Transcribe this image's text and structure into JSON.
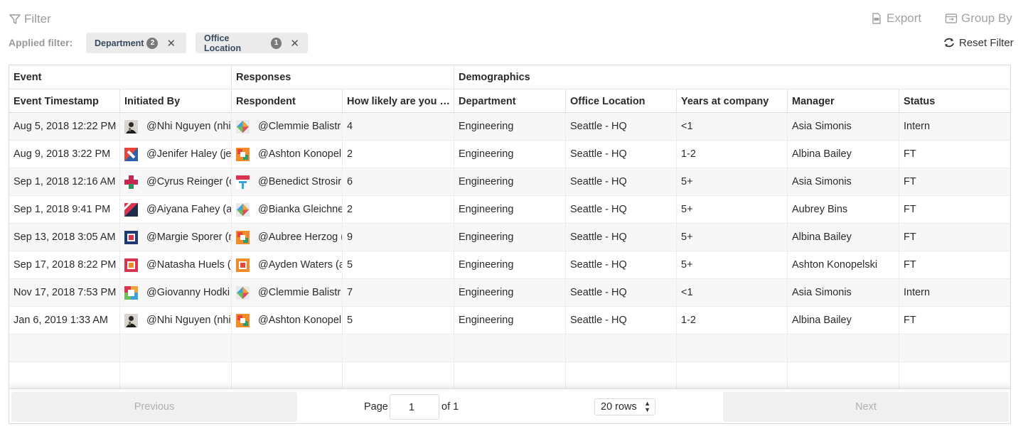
{
  "toolbar": {
    "filter_label": "Filter",
    "export_label": "Export",
    "group_by_label": "Group By",
    "reset_label": "Reset Filter",
    "applied_label": "Applied filter:",
    "chips": [
      {
        "label": "Department",
        "count": "2"
      },
      {
        "label": "Office Location",
        "count": "1"
      }
    ]
  },
  "table": {
    "groups": [
      "Event",
      "Responses",
      "Demographics"
    ],
    "columns": [
      "Event Timestamp",
      "Initiated By",
      "Respondent",
      "How likely are you …",
      "Department",
      "Office Location",
      "Years at company",
      "Manager",
      "Status"
    ],
    "rows": [
      {
        "timestamp": "Aug 5, 2018 12:22 PM",
        "initiated": "@Nhi Nguyen (nhi",
        "initiated_avatar": "photo",
        "respondent": "@Clemmie Balistr",
        "respondent_avatar": "diamond",
        "score": "4",
        "department": "Engineering",
        "office": "Seattle - HQ",
        "years": "<1",
        "manager": "Asia Simonis",
        "status": "Intern"
      },
      {
        "timestamp": "Aug 9, 2018 3:22 PM",
        "initiated": "@Jenifer Haley (je",
        "initiated_avatar": "diagonal",
        "respondent": "@Ashton Konopel",
        "respondent_avatar": "squares",
        "score": "2",
        "department": "Engineering",
        "office": "Seattle - HQ",
        "years": "1-2",
        "manager": "Albina Bailey",
        "status": "FT"
      },
      {
        "timestamp": "Sep 1, 2018 12:16 AM",
        "initiated": "@Cyrus Reinger (c",
        "initiated_avatar": "cross",
        "respondent": "@Benedict Strosir",
        "respondent_avatar": "calendar",
        "score": "6",
        "department": "Engineering",
        "office": "Seattle - HQ",
        "years": "5+",
        "manager": "Asia Simonis",
        "status": "FT"
      },
      {
        "timestamp": "Sep 1, 2018 9:41 PM",
        "initiated": "@Aiyana Fahey (a",
        "initiated_avatar": "split",
        "respondent": "@Bianka Gleichne",
        "respondent_avatar": "diamond",
        "score": "2",
        "department": "Engineering",
        "office": "Seattle - HQ",
        "years": "5+",
        "manager": "Aubrey Bins",
        "status": "FT"
      },
      {
        "timestamp": "Sep 13, 2018 3:05 AM",
        "initiated": "@Margie Sporer (r",
        "initiated_avatar": "frame-blue",
        "respondent": "@Aubree Herzog (",
        "respondent_avatar": "squares",
        "score": "9",
        "department": "Engineering",
        "office": "Seattle - HQ",
        "years": "5+",
        "manager": "Albina Bailey",
        "status": "FT"
      },
      {
        "timestamp": "Sep 17, 2018 8:22 PM",
        "initiated": "@Natasha Huels (",
        "initiated_avatar": "frame-red",
        "respondent": "@Ayden Waters (a",
        "respondent_avatar": "frame-orange",
        "score": "5",
        "department": "Engineering",
        "office": "Seattle - HQ",
        "years": "5+",
        "manager": "Ashton Konopelski",
        "status": "FT"
      },
      {
        "timestamp": "Nov 17, 2018 7:53 PM",
        "initiated": "@Giovanny Hodki",
        "initiated_avatar": "frame-multi",
        "respondent": "@Clemmie Balistr",
        "respondent_avatar": "diamond",
        "score": "7",
        "department": "Engineering",
        "office": "Seattle - HQ",
        "years": "<1",
        "manager": "Asia Simonis",
        "status": "Intern"
      },
      {
        "timestamp": "Jan 6, 2019 1:33 AM",
        "initiated": "@Nhi Nguyen (nhi",
        "initiated_avatar": "photo",
        "respondent": "@Ashton Konopel",
        "respondent_avatar": "squares",
        "score": "5",
        "department": "Engineering",
        "office": "Seattle - HQ",
        "years": "1-2",
        "manager": "Albina Bailey",
        "status": "FT"
      }
    ]
  },
  "pagination": {
    "previous_label": "Previous",
    "next_label": "Next",
    "page_label": "Page",
    "page_value": "1",
    "of_label": "of 1",
    "rows_label": "20 rows"
  },
  "colors": {
    "chip_bg": "#ebebeb",
    "muted_text": "#9a9a9a",
    "disabled_button": "#f0f0f0"
  }
}
